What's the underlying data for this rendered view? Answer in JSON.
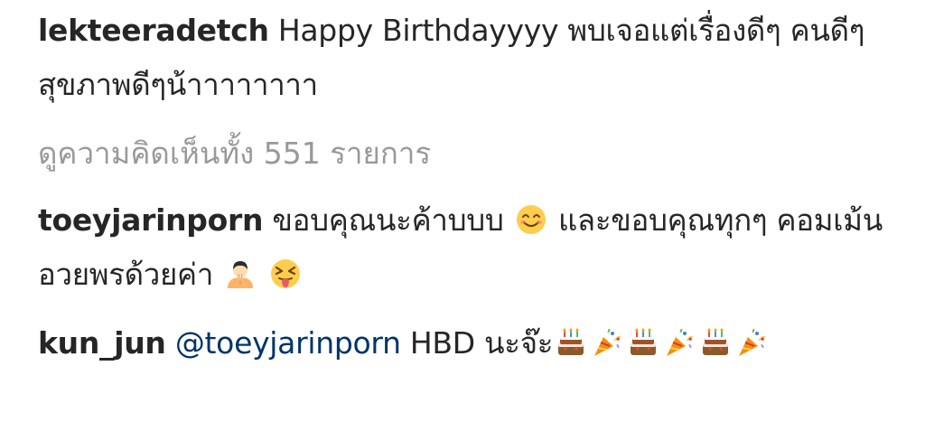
{
  "comments": [
    {
      "username": "lekteeradetch",
      "text": "Happy Birthdayyyy พบเจอแต่เรื่องดีๆ คนดีๆ สุขภาพดีๆน้าาาาาาาา"
    },
    {
      "username": "toeyjarinporn",
      "text_before_emoji": "ขอบคุณนะค้าบบบ",
      "text_after_emoji": "และขอบคุณทุกๆ คอมเม้นอวยพรด้วยค่า",
      "emojis": [
        "smiling-face-icon",
        "person-bowing-icon",
        "squinting-tongue-face-icon"
      ]
    },
    {
      "username": "kun_jun",
      "mention": "@toeyjarinporn",
      "text": "HBD นะจ๊ะ",
      "emojis": [
        "birthday-cake-icon",
        "party-popper-icon",
        "birthday-cake-icon",
        "party-popper-icon",
        "birthday-cake-icon",
        "party-popper-icon"
      ]
    }
  ],
  "view_all_comments": "ดูความคิดเห็นทั้ง 551 รายการ",
  "colors": {
    "text": "#262626",
    "muted": "#999999",
    "mention": "#003569"
  }
}
